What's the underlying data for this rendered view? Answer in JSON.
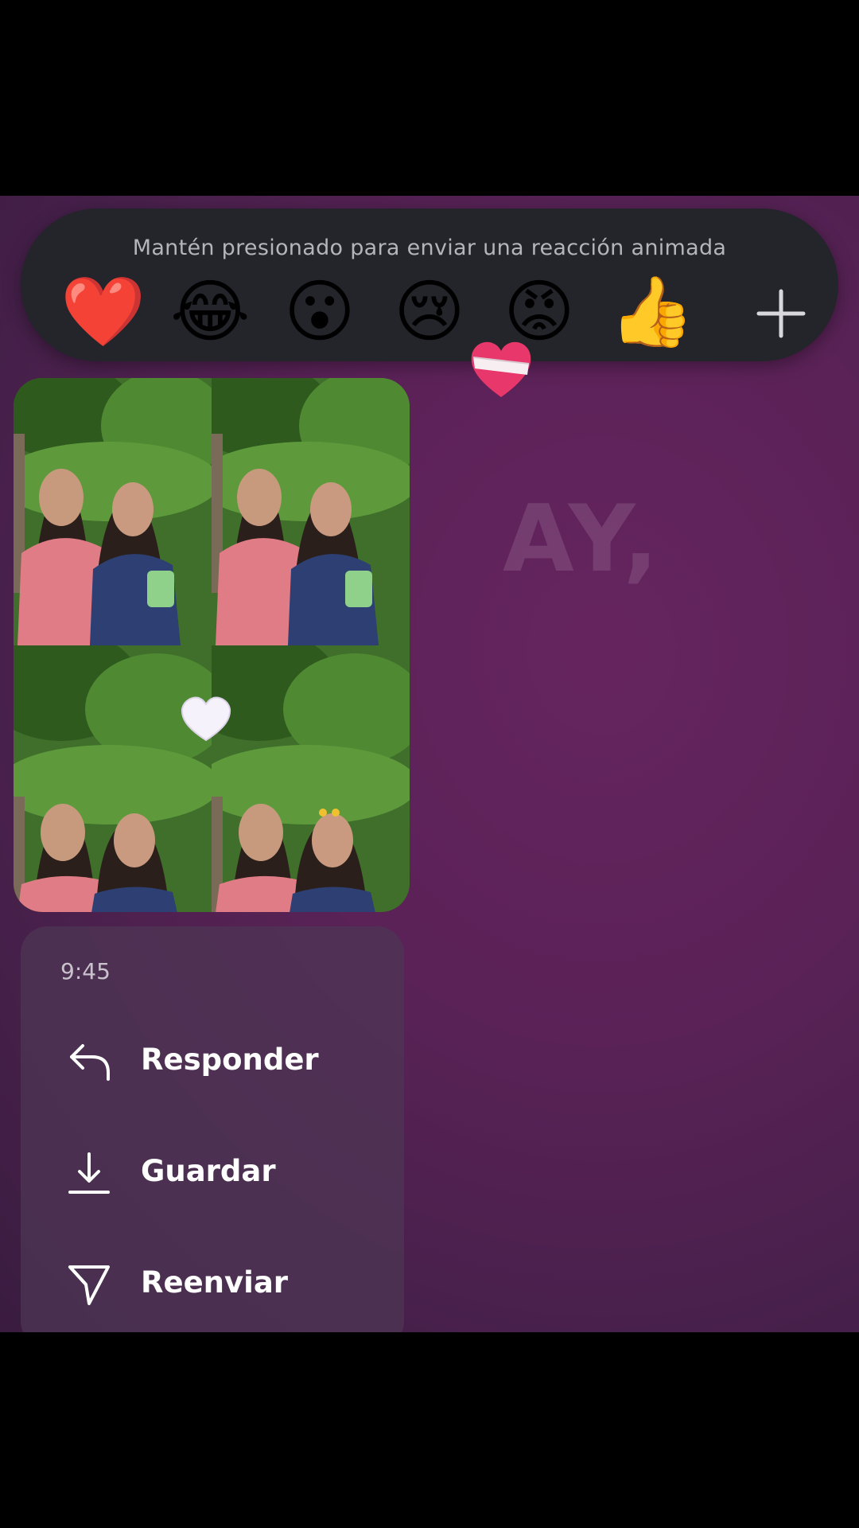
{
  "reaction_bar": {
    "hint": "Mantén presionado para enviar una reacción animada",
    "emojis": [
      {
        "char": "❤️",
        "name": "red-heart"
      },
      {
        "char": "😂",
        "name": "tears-of-joy"
      },
      {
        "char": "😮",
        "name": "open-mouth"
      },
      {
        "char": "😢",
        "name": "crying-face"
      },
      {
        "char": "😡",
        "name": "angry-face"
      },
      {
        "char": "👍",
        "name": "thumbs-up"
      }
    ],
    "plus_icon": "plus-icon"
  },
  "background_text": "AY,",
  "message": {
    "photo": "photo-collage",
    "reaction_sticker": "heart-with-bandage-icon",
    "animated_reaction": "white-heart-icon"
  },
  "context_menu": {
    "time": "9:45",
    "items": [
      {
        "label": "Responder",
        "icon": "reply-icon"
      },
      {
        "label": "Guardar",
        "icon": "download-icon"
      },
      {
        "label": "Reenviar",
        "icon": "send-icon"
      }
    ]
  },
  "colors": {
    "reaction_bar_bg": "#24242b",
    "background": "#5a2257",
    "menu_bg": "#4e3654"
  }
}
